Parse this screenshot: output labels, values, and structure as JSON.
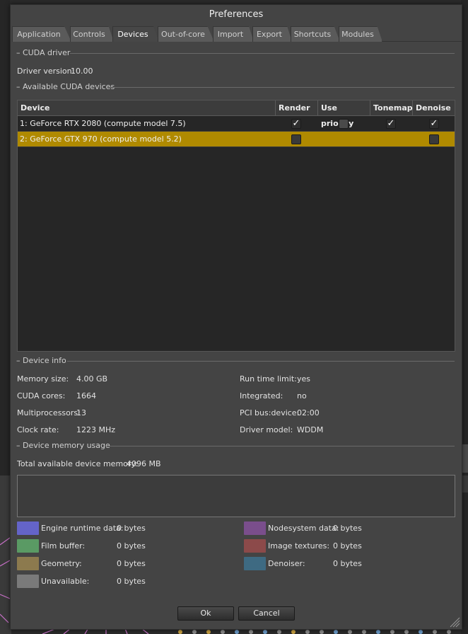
{
  "window": {
    "title": "Preferences"
  },
  "tabs": [
    {
      "label": "Application",
      "active": false
    },
    {
      "label": "Controls",
      "active": false
    },
    {
      "label": "Devices",
      "active": true
    },
    {
      "label": "Out-of-core",
      "active": false
    },
    {
      "label": "Import",
      "active": false
    },
    {
      "label": "Export",
      "active": false
    },
    {
      "label": "Shortcuts",
      "active": false
    },
    {
      "label": "Modules",
      "active": false
    }
  ],
  "cuda_driver": {
    "section_label": "– CUDA driver",
    "version_label": "Driver version:",
    "version_value": "10.00"
  },
  "devices": {
    "section_label": "– Available CUDA devices",
    "columns": [
      "Device",
      "Render",
      "Use priority",
      "Tonemap",
      "Denoise"
    ],
    "rows": [
      {
        "name": "1: GeForce RTX 2080 (compute model 7.5)",
        "render": true,
        "use_priority": false,
        "tonemap": true,
        "denoise": true,
        "selected": false
      },
      {
        "name": "2: GeForce GTX 970 (compute model 5.2)",
        "render": false,
        "use_priority": null,
        "tonemap": null,
        "denoise": false,
        "selected": true
      }
    ],
    "check_glyph": "✓"
  },
  "device_info": {
    "section_label": "– Device info",
    "left": [
      {
        "label": "Memory size:",
        "value": "4.00 GB"
      },
      {
        "label": "CUDA cores:",
        "value": "1664"
      },
      {
        "label": "Multiprocessors:",
        "value": "13"
      },
      {
        "label": "Clock rate:",
        "value": "1223 MHz"
      }
    ],
    "right": [
      {
        "label": "Run time limit:",
        "value": "yes"
      },
      {
        "label": "Integrated:",
        "value": "no"
      },
      {
        "label": "PCI bus:device:",
        "value": "02:00"
      },
      {
        "label": "Driver model:",
        "value": "WDDM"
      }
    ]
  },
  "memory_usage": {
    "section_label": "– Device memory usage",
    "total_label": "Total available device memory:",
    "total_value": "4096 MB",
    "legend_left": [
      {
        "label": "Engine runtime data:",
        "value": "0 bytes",
        "color": "#6464c8"
      },
      {
        "label": "Film buffer:",
        "value": "0 bytes",
        "color": "#5a9a64"
      },
      {
        "label": "Geometry:",
        "value": "0 bytes",
        "color": "#8c7a4e"
      },
      {
        "label": "Unavailable:",
        "value": "0 bytes",
        "color": "#7a7a7a"
      }
    ],
    "legend_right": [
      {
        "label": "Nodesystem data:",
        "value": "0 bytes",
        "color": "#7a4e8c"
      },
      {
        "label": "Image textures:",
        "value": "0 bytes",
        "color": "#8c4a4a"
      },
      {
        "label": "Denoiser:",
        "value": "0 bytes",
        "color": "#3e6a82"
      }
    ]
  },
  "buttons": {
    "ok": "Ok",
    "cancel": "Cancel"
  }
}
